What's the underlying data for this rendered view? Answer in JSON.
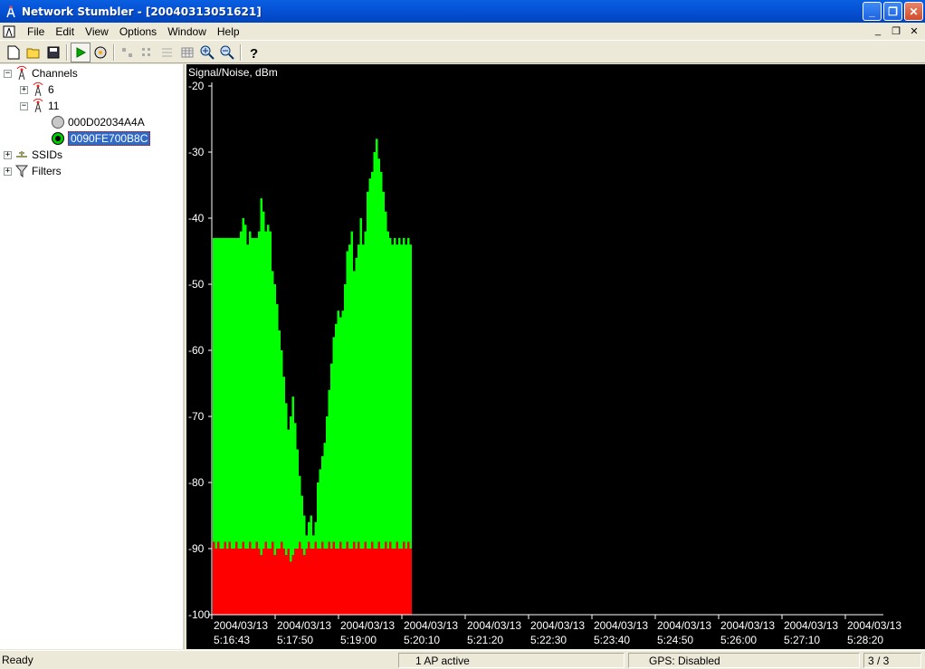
{
  "window": {
    "title": "Network Stumbler - [20040313051621]",
    "buttons": {
      "minimize": "_",
      "maximize": "❐",
      "close": "✕"
    }
  },
  "menu": {
    "items": [
      {
        "label": "File"
      },
      {
        "label": "Edit"
      },
      {
        "label": "View"
      },
      {
        "label": "Options"
      },
      {
        "label": "Window"
      },
      {
        "label": "Help"
      }
    ],
    "mdi": {
      "minimize": "_",
      "restore": "❐",
      "close": "✕"
    }
  },
  "toolbar": {
    "icons": [
      "new-file-icon",
      "open-folder-icon",
      "save-icon",
      "play-icon",
      "scan-options-icon",
      "auto-arrange-icon",
      "sort-icon",
      "list-icon",
      "grid-icon",
      "zoom-in-icon",
      "zoom-out-icon",
      "help-icon"
    ]
  },
  "tree": {
    "channels_label": "Channels",
    "channel_6": "6",
    "channel_11": "11",
    "ap_1": "000D02034A4A",
    "ap_2": "0090FE700B8C",
    "ssids_label": "SSIDs",
    "filters_label": "Filters",
    "expand_plus": "+",
    "expand_minus": "−"
  },
  "chart_data": {
    "type": "bar",
    "title": "Signal/Noise, dBm",
    "ylim": [
      -100,
      -20
    ],
    "yticks": [
      -20,
      -30,
      -40,
      -50,
      -60,
      -70,
      -80,
      -90,
      -100
    ],
    "xticks": [
      {
        "date": "2004/03/13",
        "time": "5:16:43"
      },
      {
        "date": "2004/03/13",
        "time": "5:17:50"
      },
      {
        "date": "2004/03/13",
        "time": "5:19:00"
      },
      {
        "date": "2004/03/13",
        "time": "5:20:10"
      },
      {
        "date": "2004/03/13",
        "time": "5:21:20"
      },
      {
        "date": "2004/03/13",
        "time": "5:22:30"
      },
      {
        "date": "2004/03/13",
        "time": "5:23:40"
      },
      {
        "date": "2004/03/13",
        "time": "5:24:50"
      },
      {
        "date": "2004/03/13",
        "time": "5:26:00"
      },
      {
        "date": "2004/03/13",
        "time": "5:27:10"
      },
      {
        "date": "2004/03/13",
        "time": "5:28:20"
      }
    ],
    "signal_values": [
      -43,
      -43,
      -43,
      -43,
      -43,
      -43,
      -43,
      -43,
      -43,
      -43,
      -43,
      -43,
      -42,
      -40,
      -41,
      -44,
      -42,
      -43,
      -43,
      -43,
      -42,
      -37,
      -39,
      -42,
      -41,
      -42,
      -48,
      -50,
      -53,
      -57,
      -60,
      -64,
      -68,
      -72,
      -70,
      -67,
      -71,
      -75,
      -79,
      -82,
      -85,
      -88,
      -86,
      -85,
      -88,
      -86,
      -80,
      -78,
      -76,
      -74,
      -70,
      -66,
      -62,
      -58,
      -56,
      -54,
      -55,
      -54,
      -50,
      -45,
      -44,
      -42,
      -48,
      -46,
      -44,
      -40,
      -44,
      -42,
      -36,
      -34,
      -33,
      -30,
      -28,
      -31,
      -33,
      -36,
      -39,
      -42,
      -43,
      -44,
      -43,
      -44,
      -43,
      -44,
      -43,
      -44,
      -43,
      -44
    ],
    "noise_values": [
      -89,
      -90,
      -89,
      -90,
      -90,
      -89,
      -90,
      -89,
      -90,
      -90,
      -89,
      -90,
      -90,
      -89,
      -90,
      -90,
      -89,
      -90,
      -90,
      -89,
      -90,
      -91,
      -90,
      -89,
      -90,
      -90,
      -89,
      -91,
      -90,
      -90,
      -89,
      -90,
      -91,
      -90,
      -92,
      -91,
      -90,
      -90,
      -89,
      -90,
      -91,
      -90,
      -89,
      -90,
      -90,
      -89,
      -90,
      -90,
      -89,
      -90,
      -90,
      -89,
      -90,
      -89,
      -90,
      -90,
      -89,
      -90,
      -90,
      -89,
      -90,
      -90,
      -89,
      -90,
      -89,
      -90,
      -90,
      -89,
      -90,
      -90,
      -89,
      -90,
      -90,
      -89,
      -90,
      -90,
      -89,
      -90,
      -89,
      -90,
      -90,
      -89,
      -90,
      -90,
      -89,
      -90,
      -89,
      -90
    ],
    "colors": {
      "signal": "#00ff00",
      "noise": "#ff0000",
      "background": "#000000",
      "axis": "#ffffff"
    }
  },
  "status": {
    "ready": "Ready",
    "ap_active": "1 AP active",
    "gps": "GPS: Disabled",
    "count": "3 / 3"
  }
}
